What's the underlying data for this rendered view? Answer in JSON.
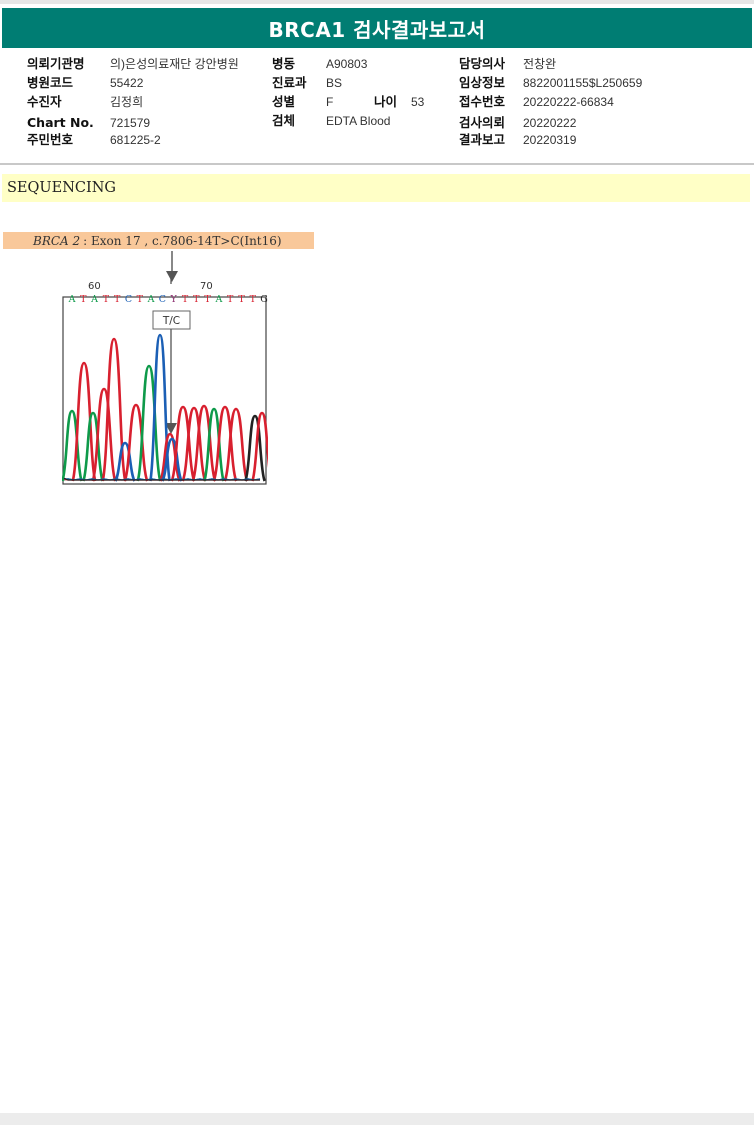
{
  "report": {
    "title": "BRCA1 검사결과보고서"
  },
  "fields": {
    "institution": {
      "label": "의뢰기관명",
      "value": "의)은성의료재단 강안병원"
    },
    "hospital_code": {
      "label": "병원코드",
      "value": "55422"
    },
    "patient": {
      "label": "수진자",
      "value": "김정희"
    },
    "chart_no": {
      "label": "Chart No.",
      "value": "721579"
    },
    "resident_no": {
      "label": "주민번호",
      "value": "681225-2"
    },
    "ward": {
      "label": "병동",
      "value": "A90803"
    },
    "department": {
      "label": "진료과",
      "value": "BS"
    },
    "sex": {
      "label": "성별",
      "value": "F"
    },
    "age": {
      "label": "나이",
      "value": "53"
    },
    "specimen": {
      "label": "검체",
      "value": "EDTA Blood"
    },
    "doctor": {
      "label": "담당의사",
      "value": "전창완"
    },
    "clinical_info": {
      "label": "임상정보",
      "value": "8822001155$L250659"
    },
    "receipt_no": {
      "label": "접수번호",
      "value": "20220222-66834"
    },
    "request_date": {
      "label": "검사의뢰",
      "value": "20220222"
    },
    "report_date": {
      "label": "결과보고",
      "value": "20220319"
    }
  },
  "section": {
    "title": "SEQUENCING"
  },
  "mutation": {
    "gene": "BRCA 2",
    "detail": ": Exon 17 , c.7806-14T>C(Int16)"
  },
  "chromatogram": {
    "positions": [
      "60",
      "70"
    ],
    "bases": [
      "A",
      "T",
      "A",
      "T",
      "T",
      "C",
      "T",
      "A",
      "C",
      "Y",
      "T",
      "T",
      "T",
      "A",
      "T",
      "T",
      "T",
      "G"
    ],
    "call_label": "T/C",
    "colors": {
      "A": "#0e9a4a",
      "T": "#d8202f",
      "C": "#1b5fb5",
      "G": "#222222",
      "Y": "#8b2b6e"
    }
  }
}
